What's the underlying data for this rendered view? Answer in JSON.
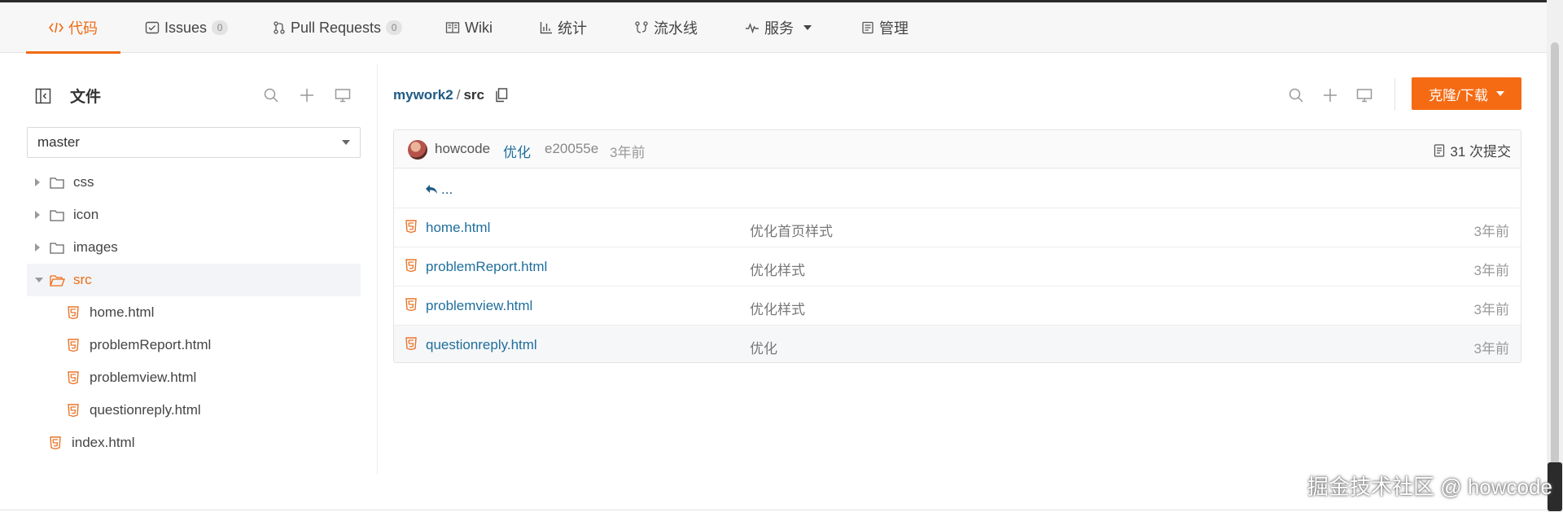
{
  "tabs": [
    {
      "label": "代码",
      "icon": "code-icon",
      "active": true
    },
    {
      "label": "Issues",
      "count": "0",
      "icon": "issues-icon"
    },
    {
      "label": "Pull Requests",
      "count": "0",
      "icon": "pull-request-icon"
    },
    {
      "label": "Wiki",
      "icon": "book-icon"
    },
    {
      "label": "统计",
      "icon": "bar-chart-icon"
    },
    {
      "label": "流水线",
      "icon": "pipeline-icon"
    },
    {
      "label": "服务",
      "icon": "pulse-icon"
    },
    {
      "label": "管理",
      "icon": "manage-icon"
    }
  ],
  "sidebar": {
    "title": "文件",
    "branch": "master",
    "tree": [
      {
        "label": "css",
        "type": "folder"
      },
      {
        "label": "icon",
        "type": "folder"
      },
      {
        "label": "images",
        "type": "folder"
      },
      {
        "label": "src",
        "type": "folder-open"
      },
      {
        "label": "home.html",
        "type": "html"
      },
      {
        "label": "problemReport.html",
        "type": "html"
      },
      {
        "label": "problemview.html",
        "type": "html"
      },
      {
        "label": "questionreply.html",
        "type": "html"
      },
      {
        "label": "index.html",
        "type": "html"
      }
    ]
  },
  "breadcrumb": {
    "repo": "mywork2",
    "sep": "/",
    "current": "src"
  },
  "clone_button": "克隆/下载",
  "commit": {
    "author": "howcode",
    "message": "优化",
    "sha": "e20055e",
    "time": "3年前",
    "count_label": "31 次提交"
  },
  "back_label": "...",
  "files": [
    {
      "name": "home.html",
      "message": "优化首页样式",
      "time": "3年前"
    },
    {
      "name": "problemReport.html",
      "message": "优化样式",
      "time": "3年前"
    },
    {
      "name": "problemview.html",
      "message": "优化样式",
      "time": "3年前"
    },
    {
      "name": "questionreply.html",
      "message": "优化",
      "time": "3年前"
    }
  ],
  "watermark": "掘金技术社区 @ howcode",
  "colors": {
    "accent": "#f06b14",
    "link": "#1f6e9c",
    "repo": "#1f5b85"
  }
}
